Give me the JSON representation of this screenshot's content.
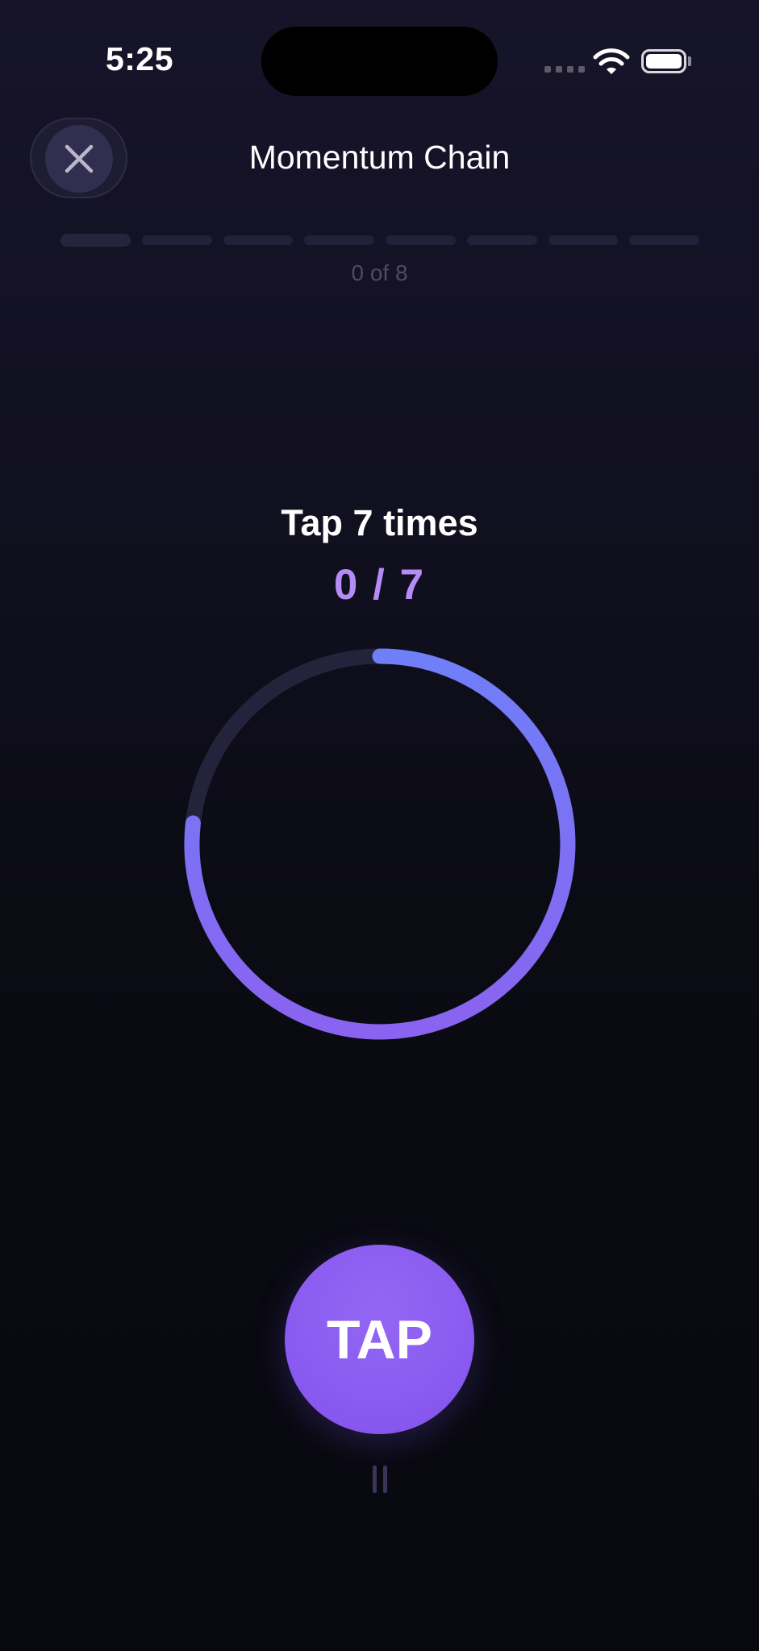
{
  "status_bar": {
    "time": "5:25"
  },
  "header": {
    "title": "Momentum Chain",
    "close_icon": "close-icon"
  },
  "steps": {
    "current": 0,
    "total": 8,
    "label": "0 of 8"
  },
  "challenge": {
    "instruction": "Tap 7 times",
    "counter_label": "0 / 7",
    "taps_done": 0,
    "taps_required": 7
  },
  "ring": {
    "gradient_start": "#6f7ff8",
    "gradient_end": "#8a63f0",
    "track_color": "#25223b"
  },
  "tap_button": {
    "label": "TAP",
    "color": "#8a5bf0"
  },
  "pause_icon": "pause-icon",
  "colors": {
    "accent": "#b58bf5",
    "background": "#0b0b14"
  }
}
